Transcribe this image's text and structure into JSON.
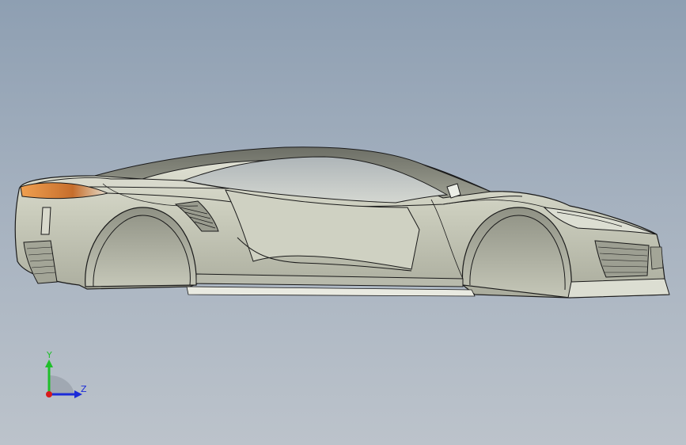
{
  "viewport": {
    "background_top": "#8e9fb2",
    "background_bottom": "#bcc3cb"
  },
  "model": {
    "body_color": "#c9cbbb",
    "edge_color": "#1a1a1a",
    "glass_color": "#b9c0c4",
    "taillight_color": "#d98a3c"
  },
  "triad": {
    "y_label": "Y",
    "z_label": "Z",
    "y_color": "#1fbf2a",
    "z_color": "#1b2bd8",
    "x_color": "#d81b1b"
  }
}
